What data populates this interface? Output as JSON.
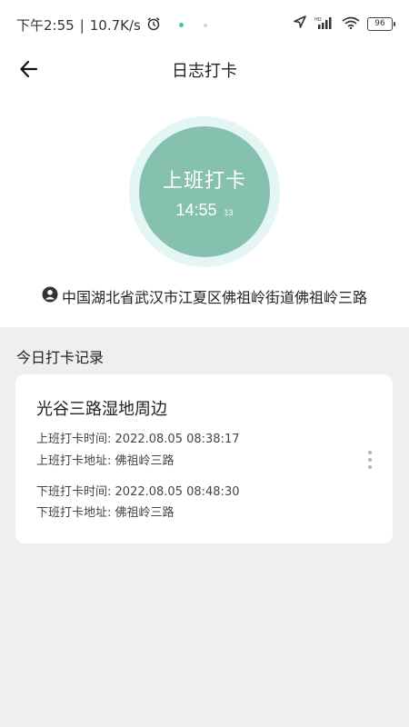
{
  "status_bar": {
    "time": "下午2:55",
    "separator": "|",
    "speed": "10.7K/s",
    "battery": "96"
  },
  "header": {
    "title": "日志打卡"
  },
  "clock_in": {
    "label": "上班打卡",
    "time": "14:55",
    "seconds": "13"
  },
  "location": {
    "text": "中国湖北省武汉市江夏区佛祖岭街道佛祖岭三路"
  },
  "records": {
    "section_title": "今日打卡记录",
    "card": {
      "place": "光谷三路湿地周边",
      "on_time_label": "上班打卡时间:",
      "on_time_value": "2022.08.05 08:38:17",
      "on_addr_label": "上班打卡地址:",
      "on_addr_value": "佛祖岭三路",
      "off_time_label": "下班打卡时间:",
      "off_time_value": "2022.08.05 08:48:30",
      "off_addr_label": "下班打卡地址:",
      "off_addr_value": "佛祖岭三路"
    }
  },
  "colors": {
    "accent": "#86c0af",
    "ring": "#e4f6f3",
    "background": "#efefef"
  }
}
